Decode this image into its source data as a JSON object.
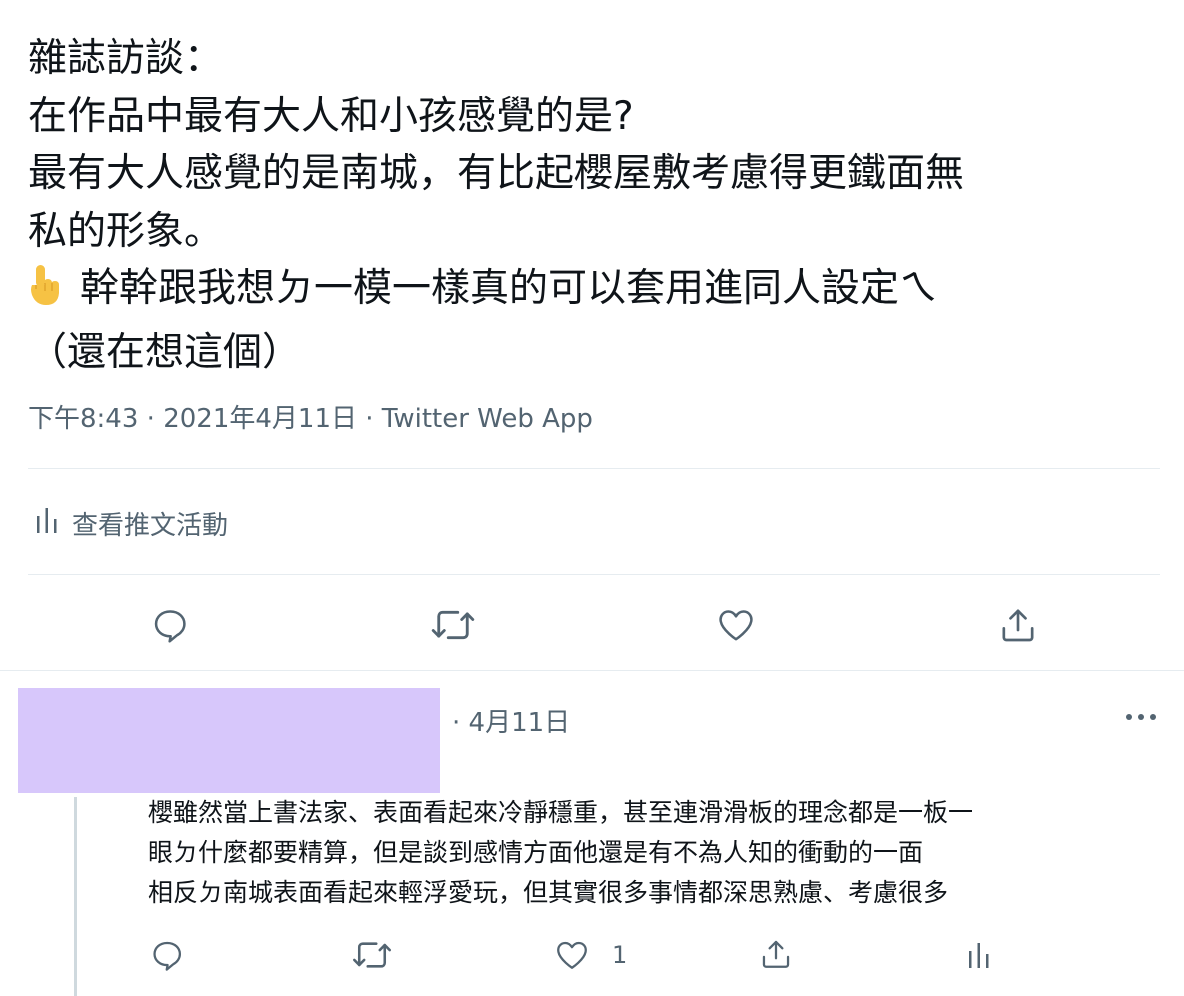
{
  "tweet": {
    "lines": [
      "雜誌訪談：",
      "在作品中最有大人和小孩感覺的是?",
      "最有大人感覺的是南城，有比起櫻屋敷考慮得更鐵面無",
      "私的形象。",
      "幹幹跟我想ㄉ一模一樣真的可以套用進同人設定ㄟ",
      "（還在想這個）"
    ],
    "emoji": "👆",
    "time": "下午8:43",
    "date": "2021年4月11日",
    "source": "Twitter Web App",
    "separator": "·",
    "activity_label": "查看推文活動"
  },
  "icons": {
    "reply": "reply-icon",
    "retweet": "retweet-icon",
    "like": "heart-icon",
    "share": "share-icon",
    "analytics": "analytics-icon",
    "more": "more-icon"
  },
  "reply": {
    "date": "· 4月11日",
    "lines": [
      "櫻雖然當上書法家、表面看起來冷靜穩重，甚至連滑滑板的理念都是一板一",
      "眼ㄉ什麼都要精算，但是談到感情方面他還是有不為人知的衝動的一面",
      "相反ㄉ南城表面看起來輕浮愛玩，但其實很多事情都深思熟慮、考慮很多"
    ],
    "like_count": "1"
  },
  "colors": {
    "text": "#0f1419",
    "secondary": "#536471",
    "divider": "#e6ecf0",
    "avatar_placeholder": "#d7c7fb",
    "thread_line": "#cfd9de"
  }
}
